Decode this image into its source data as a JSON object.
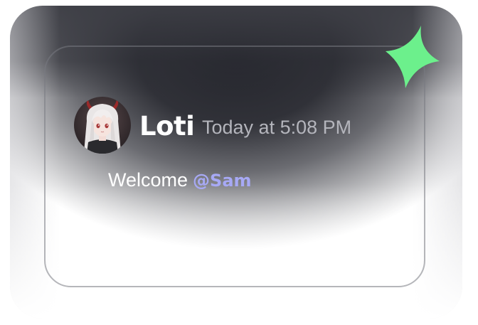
{
  "message": {
    "author": "Loti",
    "timestamp": "Today at 5:08 PM",
    "text": "Welcome",
    "mention": "@Sam"
  },
  "avatar": {
    "icon": "anime-avatar-icon",
    "hair_color": "#e9e6e6",
    "outfit_color": "#2a2a2e",
    "horn_color": "#9a2a2a"
  },
  "sparkle": {
    "icon": "sparkle-icon",
    "color": "#6cf08c"
  },
  "colors": {
    "card_bg": "#2b2c33",
    "author": "#ffffff",
    "timestamp": "#b4b5bc",
    "mention": "#a7a9f5"
  }
}
